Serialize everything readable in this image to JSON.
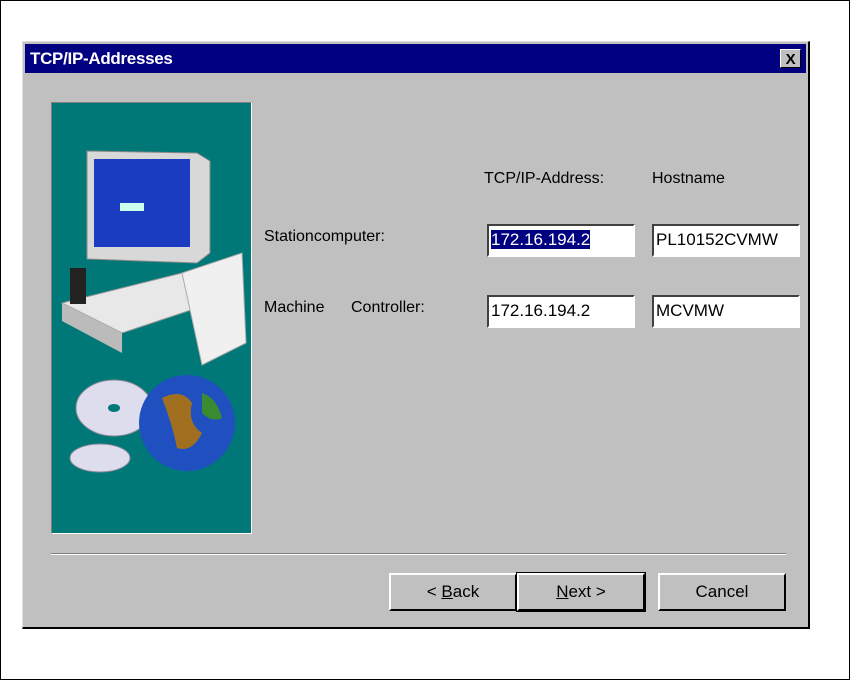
{
  "window": {
    "title": "TCP/IP-Addresses",
    "close_label": "X"
  },
  "columns": {
    "address": "TCP/IP-Address:",
    "hostname": "Hostname"
  },
  "rows": [
    {
      "label_a": "Stationcomputer:",
      "label_b": "",
      "address": "172.16.194.2",
      "hostname": "PL10152CVMW"
    },
    {
      "label_a": "Machine",
      "label_b": "Controller:",
      "address": "172.16.194.2",
      "hostname": "MCVMW"
    }
  ],
  "buttons": {
    "back_prefix": "< ",
    "back_key": "B",
    "back_rest": "ack",
    "next_key": "N",
    "next_rest": "ext >",
    "cancel": "Cancel"
  }
}
